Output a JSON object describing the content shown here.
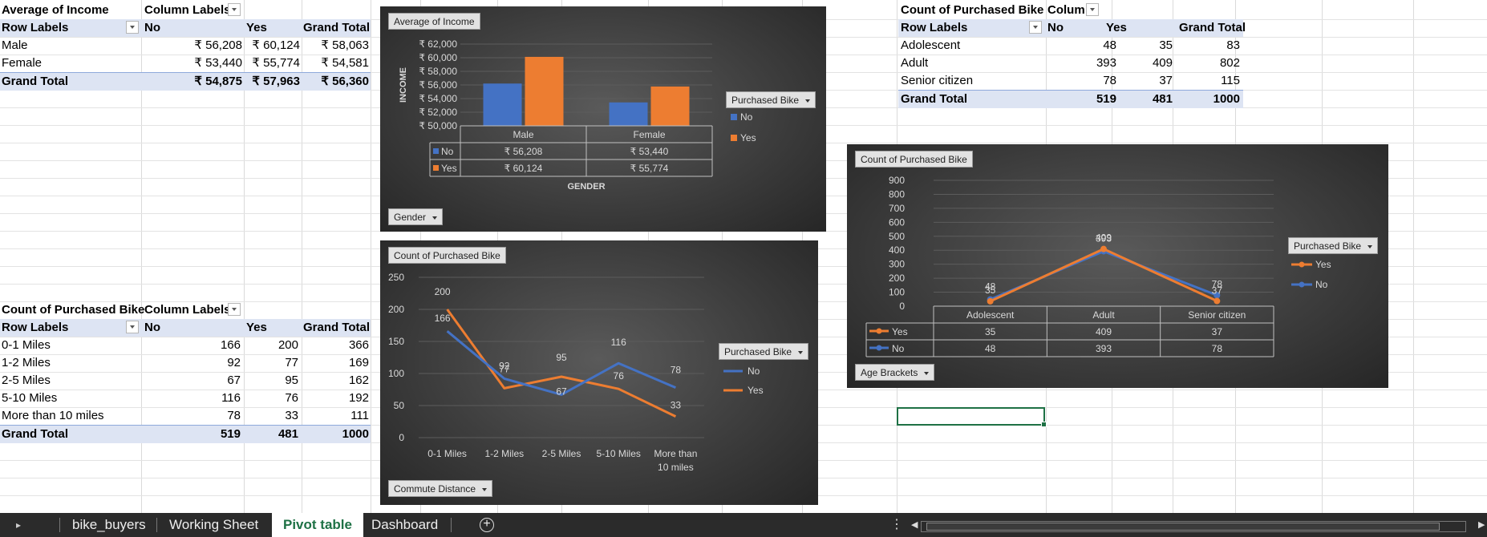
{
  "colors": {
    "no": "#4472c4",
    "yes": "#ed7d31",
    "accent": "#1e7145"
  },
  "pivot_income": {
    "title": "Average of Income",
    "col_labels": "Column Labels",
    "row_labels": "Row Labels",
    "headers": [
      "No",
      "Yes",
      "Grand Total"
    ],
    "rows": [
      {
        "label": "Male",
        "values": [
          "₹ 56,208",
          "₹ 60,124",
          "₹ 58,063"
        ]
      },
      {
        "label": "Female",
        "values": [
          "₹ 53,440",
          "₹ 55,774",
          "₹ 54,581"
        ]
      }
    ],
    "total": {
      "label": "Grand Total",
      "values": [
        "₹ 54,875",
        "₹ 57,963",
        "₹ 56,360"
      ]
    }
  },
  "pivot_commute": {
    "title": "Count of Purchased Bike",
    "col_labels": "Column Labels",
    "row_labels": "Row Labels",
    "headers": [
      "No",
      "Yes",
      "Grand Total"
    ],
    "rows": [
      {
        "label": "0-1 Miles",
        "values": [
          "166",
          "200",
          "366"
        ]
      },
      {
        "label": "1-2 Miles",
        "values": [
          "92",
          "77",
          "169"
        ]
      },
      {
        "label": "2-5 Miles",
        "values": [
          "67",
          "95",
          "162"
        ]
      },
      {
        "label": "5-10 Miles",
        "values": [
          "116",
          "76",
          "192"
        ]
      },
      {
        "label": "More than 10 miles",
        "values": [
          "78",
          "33",
          "111"
        ]
      }
    ],
    "total": {
      "label": "Grand Total",
      "values": [
        "519",
        "481",
        "1000"
      ]
    }
  },
  "pivot_age": {
    "title": "Count of Purchased Bike",
    "col_labels": "Colum",
    "row_labels": "Row Labels",
    "headers": [
      "No",
      "Yes",
      "Grand Total"
    ],
    "rows": [
      {
        "label": "Adolescent",
        "values": [
          "48",
          "35",
          "83"
        ]
      },
      {
        "label": "Adult",
        "values": [
          "393",
          "409",
          "802"
        ]
      },
      {
        "label": "Senior citizen",
        "values": [
          "78",
          "37",
          "115"
        ]
      }
    ],
    "total": {
      "label": "Grand Total",
      "values": [
        "519",
        "481",
        "1000"
      ]
    }
  },
  "charts": {
    "income": {
      "title_button": "Average of Income",
      "filter_button": "Gender",
      "legend_button": "Purchased Bike",
      "legend": [
        "No",
        "Yes"
      ],
      "ylabel": "INCOME",
      "xlabel": "GENDER"
    },
    "commute": {
      "title_button": "Count of Purchased Bike",
      "filter_button": "Commute Distance",
      "legend_button": "Purchased Bike",
      "legend": [
        "No",
        "Yes"
      ]
    },
    "age": {
      "title_button": "Count of Purchased Bike",
      "filter_button": "Age Brackets",
      "legend_button": "Purchased Bike",
      "legend": [
        "Yes",
        "No"
      ]
    }
  },
  "chart_data": [
    {
      "type": "bar",
      "categories": [
        "Male",
        "Female"
      ],
      "series": [
        {
          "name": "No",
          "values": [
            56208,
            53440
          ],
          "labels": [
            "₹ 56,208",
            "₹ 53,440"
          ]
        },
        {
          "name": "Yes",
          "values": [
            60124,
            55774
          ],
          "labels": [
            "₹ 60,124",
            "₹ 55,774"
          ]
        }
      ],
      "ylabel": "INCOME",
      "xlabel": "GENDER",
      "ylim": [
        50000,
        62000
      ],
      "yticks": [
        "₹ 50,000",
        "₹ 52,000",
        "₹ 54,000",
        "₹ 56,000",
        "₹ 58,000",
        "₹ 60,000",
        "₹ 62,000"
      ],
      "yticks_values": [
        50000,
        52000,
        54000,
        56000,
        58000,
        60000,
        62000
      ],
      "legend_position": "right",
      "data_table": true
    },
    {
      "type": "line",
      "categories": [
        "0-1 Miles",
        "1-2 Miles",
        "2-5 Miles",
        "5-10 Miles",
        "More than 10 miles"
      ],
      "category_display": [
        [
          "0-1 Miles"
        ],
        [
          "1-2 Miles"
        ],
        [
          "2-5 Miles"
        ],
        [
          "5-10 Miles"
        ],
        [
          "More than",
          "10 miles"
        ]
      ],
      "series": [
        {
          "name": "No",
          "values": [
            166,
            92,
            67,
            116,
            78
          ]
        },
        {
          "name": "Yes",
          "values": [
            200,
            77,
            95,
            76,
            33
          ]
        }
      ],
      "ylim": [
        0,
        250
      ],
      "yticks": [
        0,
        50,
        100,
        150,
        200,
        250
      ],
      "legend_position": "right",
      "data_labels": true
    },
    {
      "type": "line",
      "categories": [
        "Adolescent",
        "Adult",
        "Senior citizen"
      ],
      "series": [
        {
          "name": "Yes",
          "values": [
            35,
            409,
            37
          ]
        },
        {
          "name": "No",
          "values": [
            48,
            393,
            78
          ]
        }
      ],
      "ylim": [
        0,
        900
      ],
      "yticks": [
        0,
        100,
        200,
        300,
        400,
        500,
        600,
        700,
        800,
        900
      ],
      "legend_position": "right",
      "data_labels": true,
      "data_table": true
    }
  ],
  "tabs": [
    "bike_buyers",
    "Working Sheet",
    "Pivot table",
    "Dashboard"
  ],
  "active_tab": "Pivot table",
  "icons": {
    "nav": "sheet-nav-arrow-icon",
    "add": "add-sheet-icon",
    "more": "more-options-icon"
  }
}
